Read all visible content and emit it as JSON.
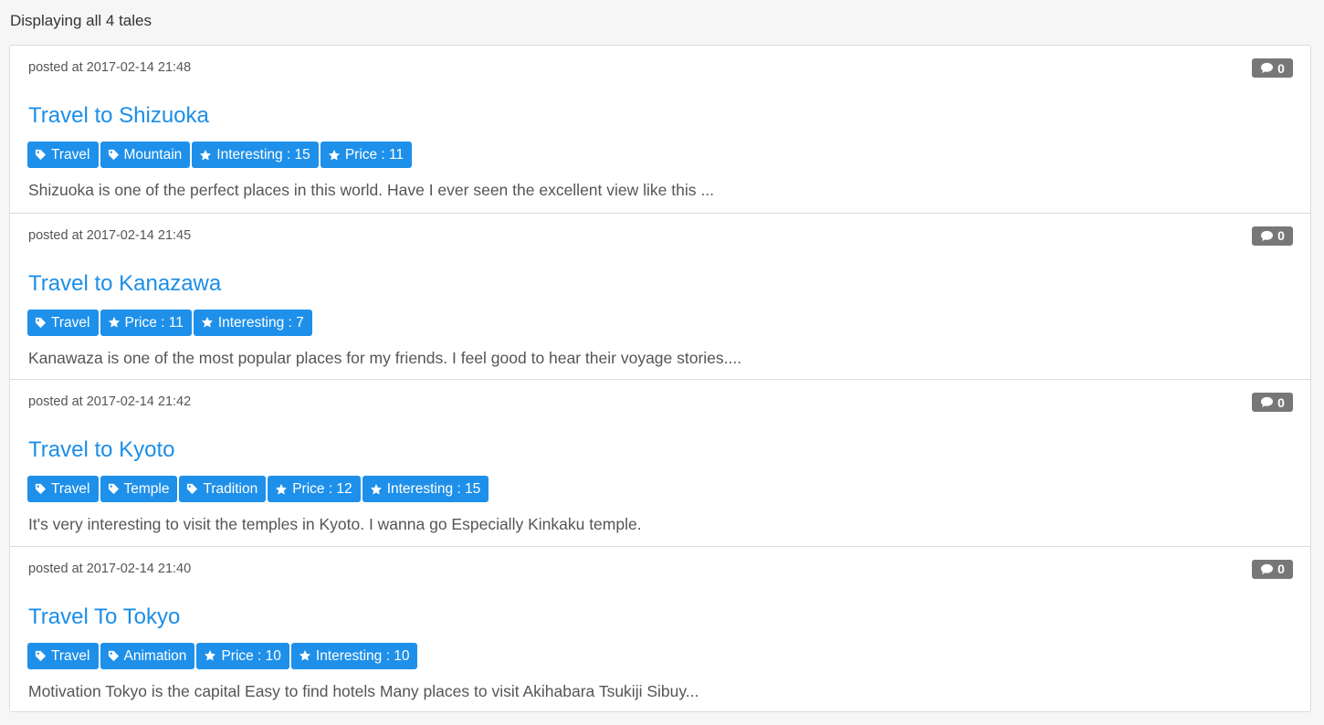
{
  "summary": {
    "prefix": "Displaying ",
    "bold": "all 4",
    "suffix": " tales"
  },
  "posted_prefix": "posted at ",
  "tales": [
    {
      "timestamp": "2017-02-14 21:48",
      "comments": "0",
      "title": "Travel to Shizuoka",
      "tags": [
        {
          "icon": "tag-icon",
          "label": "Travel"
        },
        {
          "icon": "tag-icon",
          "label": "Mountain"
        },
        {
          "icon": "star-icon",
          "label": "Interesting : 15"
        },
        {
          "icon": "star-icon",
          "label": "Price : 11"
        }
      ],
      "excerpt": "Shizuoka is one of the perfect places in this world. Have I ever seen the excellent view like this ..."
    },
    {
      "timestamp": "2017-02-14 21:45",
      "comments": "0",
      "title": "Travel to Kanazawa",
      "tags": [
        {
          "icon": "tag-icon",
          "label": "Travel"
        },
        {
          "icon": "star-icon",
          "label": "Price : 11"
        },
        {
          "icon": "star-icon",
          "label": "Interesting : 7"
        }
      ],
      "excerpt": "Kanawaza is one of the most popular places for my friends. I feel good to hear their voyage stories...."
    },
    {
      "timestamp": "2017-02-14 21:42",
      "comments": "0",
      "title": "Travel to Kyoto",
      "tags": [
        {
          "icon": "tag-icon",
          "label": "Travel"
        },
        {
          "icon": "tag-icon",
          "label": "Temple"
        },
        {
          "icon": "tag-icon",
          "label": "Tradition"
        },
        {
          "icon": "star-icon",
          "label": "Price : 12"
        },
        {
          "icon": "star-icon",
          "label": "Interesting : 15"
        }
      ],
      "excerpt": "It's very interesting to visit the temples in Kyoto. I wanna go Especially Kinkaku temple."
    },
    {
      "timestamp": "2017-02-14 21:40",
      "comments": "0",
      "title": "Travel To Tokyo",
      "tags": [
        {
          "icon": "tag-icon",
          "label": "Travel"
        },
        {
          "icon": "tag-icon",
          "label": "Animation"
        },
        {
          "icon": "star-icon",
          "label": "Price : 10"
        },
        {
          "icon": "star-icon",
          "label": "Interesting : 10"
        }
      ],
      "excerpt": "Motivation Tokyo is the capital Easy to find hotels Many places to visit Akihabara Tsukiji Sibuy..."
    }
  ],
  "colors": {
    "accent": "#1e90ea",
    "title_link": "#1b8ee8",
    "comment_badge": "#777777"
  }
}
